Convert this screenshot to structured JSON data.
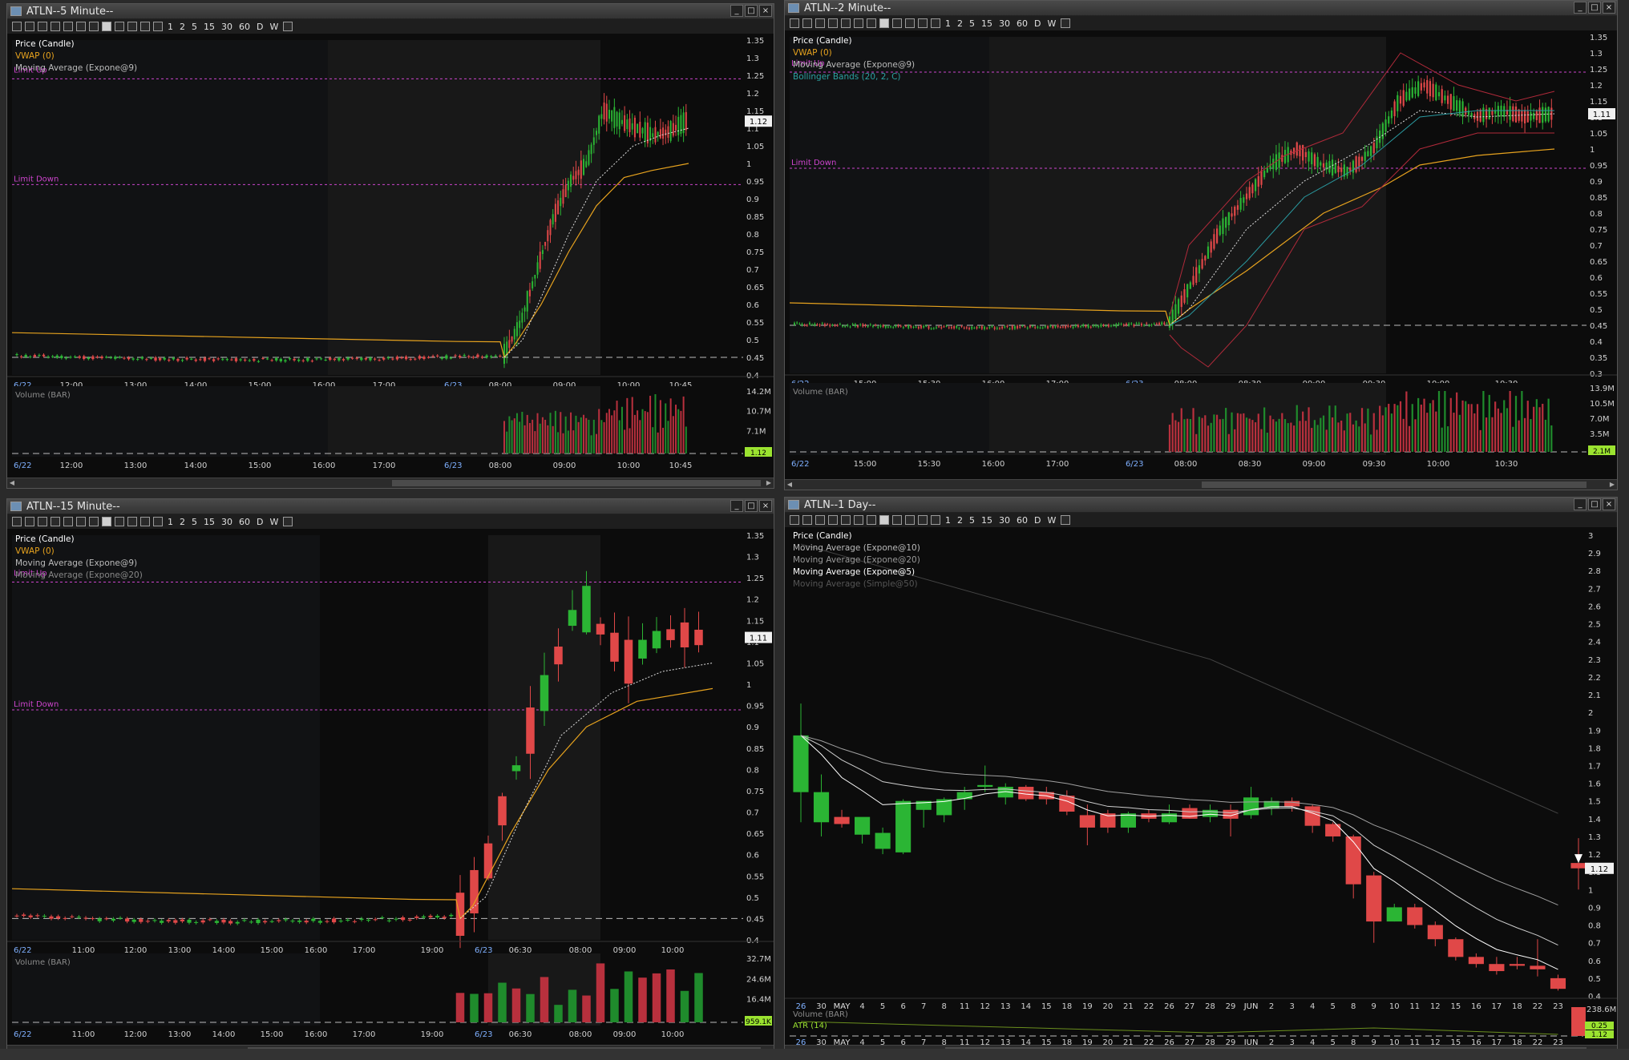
{
  "toolbar_items": [
    "1",
    "2",
    "5",
    "15",
    "30",
    "60",
    "D",
    "W"
  ],
  "colors": {
    "up": "#2bb534",
    "down": "#e04848",
    "vwap": "#e6a21e",
    "ma": "#c8c8c8",
    "limit": "#cc44cc",
    "bb": "#b02a3a",
    "grid": "#1a1a1a"
  },
  "panes": [
    {
      "title": "ATLN--5 Minute--",
      "legend": [
        "Price (Candle)",
        "VWAP (0)",
        "Moving Average (Expone@9)"
      ],
      "legend_colors": [
        "#ffffff",
        "#e6a21e",
        "#bbbbbb"
      ],
      "limit_up_label": "Limit Up",
      "limit_down_label": "Limit Down",
      "price_label": "1.12",
      "volume_label": "Volume (BAR)",
      "volume_price_label": "1.12",
      "price_axis": [
        "1.35",
        "1.3",
        "1.25",
        "1.2",
        "1.15",
        "1.1",
        "1.05",
        "1",
        "0.95",
        "0.9",
        "0.85",
        "0.8",
        "0.75",
        "0.7",
        "0.65",
        "0.6",
        "0.55",
        "0.5",
        "0.45",
        "0.4"
      ],
      "volume_axis": [
        "14.2M",
        "10.7M",
        "7.1M",
        "3.6M"
      ],
      "time_axis": [
        "6/22",
        "12:00",
        "13:00",
        "14:00",
        "15:00",
        "16:00",
        "17:00",
        "6/23",
        "08:00",
        "09:00",
        "10:00",
        "10:45"
      ]
    },
    {
      "title": "ATLN--2 Minute--",
      "legend": [
        "Price (Candle)",
        "VWAP (0)",
        "Moving Average (Expone@9)",
        "Bollinger Bands (20, 2, C)"
      ],
      "legend_colors": [
        "#ffffff",
        "#e6a21e",
        "#bbbbbb",
        "#2aa0a0"
      ],
      "limit_up_label": "Limit Up",
      "limit_down_label": "Limit Down",
      "price_label": "1.11",
      "volume_label": "Volume (BAR)",
      "volume_price_label": "2.1M",
      "price_axis": [
        "1.35",
        "1.3",
        "1.25",
        "1.2",
        "1.15",
        "1.1",
        "1.05",
        "1",
        "0.95",
        "0.9",
        "0.85",
        "0.8",
        "0.75",
        "0.7",
        "0.65",
        "0.6",
        "0.55",
        "0.5",
        "0.45",
        "0.4",
        "0.35",
        "0.3"
      ],
      "volume_axis": [
        "13.9M",
        "10.5M",
        "7.0M",
        "3.5M",
        "0"
      ],
      "time_axis": [
        "6/22",
        "15:00",
        "15:30",
        "16:00",
        "17:00",
        "6/23",
        "08:00",
        "08:30",
        "09:00",
        "09:30",
        "10:00",
        "10:30"
      ]
    },
    {
      "title": "ATLN--15 Minute--",
      "legend": [
        "Price (Candle)",
        "VWAP (0)",
        "Moving Average (Expone@9)",
        "Moving Average (Expone@20)"
      ],
      "legend_colors": [
        "#ffffff",
        "#e6a21e",
        "#bbbbbb",
        "#888888"
      ],
      "limit_up_label": "Limit Up",
      "limit_down_label": "Limit Down",
      "price_label": "1.11",
      "volume_label": "Volume (BAR)",
      "volume_price_label": "959.1K",
      "price_axis": [
        "1.35",
        "1.3",
        "1.25",
        "1.2",
        "1.15",
        "1.1",
        "1.05",
        "1",
        "0.95",
        "0.9",
        "0.85",
        "0.8",
        "0.75",
        "0.7",
        "0.65",
        "0.6",
        "0.55",
        "0.5",
        "0.45",
        "0.4"
      ],
      "volume_axis": [
        "32.7M",
        "24.6M",
        "16.4M",
        "8.2M"
      ],
      "time_axis": [
        "6/22",
        "11:00",
        "12:00",
        "13:00",
        "14:00",
        "15:00",
        "16:00",
        "17:00",
        "19:00",
        "6/23",
        "06:30",
        "08:00",
        "09:00",
        "10:00"
      ]
    },
    {
      "title": "ATLN--1 Day--",
      "legend": [
        "Price (Candle)",
        "Moving Average (Expone@10)",
        "Moving Average (Expone@20)",
        "Moving Average (Expone@5)",
        "Moving Average (Simple@50)"
      ],
      "legend_colors": [
        "#ffffff",
        "#bbbbbb",
        "#999999",
        "#ffffff",
        "#555555"
      ],
      "limit_up_label": "",
      "limit_down_label": "",
      "price_label": "1.12",
      "volume_label": "Volume (BAR)",
      "atr_label": "ATR (14)",
      "volume_price_label": "0.25",
      "volume_price_label2": "1.12",
      "price_axis": [
        "3",
        "2.9",
        "2.8",
        "2.7",
        "2.6",
        "2.5",
        "2.4",
        "2.3",
        "2.2",
        "2.1",
        "2",
        "1.9",
        "1.8",
        "1.7",
        "1.6",
        "1.5",
        "1.4",
        "1.3",
        "1.2",
        "1.1",
        "1",
        "0.9",
        "0.8",
        "0.7",
        "0.6",
        "0.5",
        "0.4"
      ],
      "volume_axis": [
        "238.6M"
      ],
      "time_axis": [
        "26",
        "30",
        "MAY",
        "4",
        "5",
        "6",
        "7",
        "8",
        "11",
        "12",
        "13",
        "14",
        "15",
        "18",
        "19",
        "20",
        "21",
        "22",
        "26",
        "27",
        "28",
        "29",
        "JUN",
        "2",
        "3",
        "4",
        "5",
        "8",
        "9",
        "10",
        "11",
        "12",
        "15",
        "16",
        "17",
        "18",
        "22",
        "23"
      ]
    }
  ],
  "chart_data": [
    {
      "type": "candlestick",
      "title": "ATLN--5 Minute--",
      "ylim": [
        0.4,
        1.35
      ],
      "limit_up": 1.24,
      "limit_down": 0.94,
      "x": [
        "6/22",
        "12:00",
        "13:00",
        "14:00",
        "15:00",
        "16:00",
        "17:00",
        "6/23",
        "08:00",
        "09:00",
        "10:00",
        "10:45"
      ],
      "close_path": [
        0.45,
        0.44,
        0.43,
        0.44,
        0.44,
        0.44,
        0.45,
        0.45,
        0.48,
        0.85,
        1.12,
        1.12
      ],
      "last": 1.12
    },
    {
      "type": "candlestick",
      "title": "ATLN--2 Minute--",
      "ylim": [
        0.3,
        1.35
      ],
      "limit_up": 1.24,
      "limit_down": 0.94,
      "x": [
        "6/22",
        "15:00",
        "15:30",
        "16:00",
        "17:00",
        "6/23",
        "08:00",
        "08:30",
        "09:00",
        "09:30",
        "10:00",
        "10:30"
      ],
      "close_path": [
        0.45,
        0.45,
        0.45,
        0.44,
        0.44,
        0.44,
        0.5,
        0.85,
        0.95,
        1.15,
        1.1,
        1.11
      ],
      "last": 1.11
    },
    {
      "type": "candlestick",
      "title": "ATLN--15 Minute--",
      "ylim": [
        0.4,
        1.35
      ],
      "limit_up": 1.24,
      "limit_down": 0.94,
      "x": [
        "6/22",
        "11:00",
        "12:00",
        "13:00",
        "14:00",
        "15:00",
        "16:00",
        "17:00",
        "19:00",
        "6/23",
        "06:30",
        "08:00",
        "09:00",
        "10:00"
      ],
      "close_path": [
        0.5,
        0.48,
        0.47,
        0.46,
        0.45,
        0.45,
        0.45,
        0.45,
        0.45,
        0.45,
        0.45,
        0.6,
        1.15,
        1.11
      ],
      "last": 1.11
    },
    {
      "type": "candlestick",
      "title": "ATLN--1 Day--",
      "ylim": [
        0.4,
        3.0
      ],
      "x": [
        "26",
        "30",
        "MAY",
        "4",
        "5",
        "6",
        "7",
        "8",
        "11",
        "12",
        "13",
        "14",
        "15",
        "18",
        "19",
        "20",
        "21",
        "22",
        "26",
        "27",
        "28",
        "29",
        "JUN",
        "2",
        "3",
        "4",
        "5",
        "8",
        "9",
        "10",
        "11",
        "12",
        "15",
        "16",
        "17",
        "18",
        "22",
        "23"
      ],
      "candles": [
        {
          "o": 1.55,
          "h": 2.05,
          "l": 1.38,
          "c": 1.87
        },
        {
          "o": 1.38,
          "h": 1.65,
          "l": 1.3,
          "c": 1.55
        },
        {
          "o": 1.41,
          "h": 1.45,
          "l": 1.35,
          "c": 1.37
        },
        {
          "o": 1.31,
          "h": 1.4,
          "l": 1.26,
          "c": 1.41
        },
        {
          "o": 1.23,
          "h": 1.35,
          "l": 1.2,
          "c": 1.32
        },
        {
          "o": 1.21,
          "h": 1.51,
          "l": 1.2,
          "c": 1.5
        },
        {
          "o": 1.45,
          "h": 1.5,
          "l": 1.35,
          "c": 1.5
        },
        {
          "o": 1.42,
          "h": 1.52,
          "l": 1.38,
          "c": 1.51
        },
        {
          "o": 1.51,
          "h": 1.58,
          "l": 1.45,
          "c": 1.55
        },
        {
          "o": 1.58,
          "h": 1.7,
          "l": 1.55,
          "c": 1.59
        },
        {
          "o": 1.52,
          "h": 1.6,
          "l": 1.48,
          "c": 1.58
        },
        {
          "o": 1.58,
          "h": 1.59,
          "l": 1.5,
          "c": 1.51
        },
        {
          "o": 1.55,
          "h": 1.58,
          "l": 1.48,
          "c": 1.51
        },
        {
          "o": 1.53,
          "h": 1.56,
          "l": 1.42,
          "c": 1.44
        },
        {
          "o": 1.42,
          "h": 1.48,
          "l": 1.25,
          "c": 1.35
        },
        {
          "o": 1.43,
          "h": 1.45,
          "l": 1.32,
          "c": 1.35
        },
        {
          "o": 1.35,
          "h": 1.44,
          "l": 1.32,
          "c": 1.43
        },
        {
          "o": 1.43,
          "h": 1.45,
          "l": 1.38,
          "c": 1.4
        },
        {
          "o": 1.38,
          "h": 1.48,
          "l": 1.37,
          "c": 1.43
        },
        {
          "o": 1.46,
          "h": 1.48,
          "l": 1.4,
          "c": 1.4
        },
        {
          "o": 1.41,
          "h": 1.48,
          "l": 1.38,
          "c": 1.45
        },
        {
          "o": 1.45,
          "h": 1.48,
          "l": 1.3,
          "c": 1.4
        },
        {
          "o": 1.42,
          "h": 1.58,
          "l": 1.4,
          "c": 1.52
        },
        {
          "o": 1.46,
          "h": 1.52,
          "l": 1.42,
          "c": 1.5
        },
        {
          "o": 1.5,
          "h": 1.52,
          "l": 1.44,
          "c": 1.47
        },
        {
          "o": 1.47,
          "h": 1.48,
          "l": 1.32,
          "c": 1.36
        },
        {
          "o": 1.37,
          "h": 1.38,
          "l": 1.27,
          "c": 1.3
        },
        {
          "o": 1.3,
          "h": 1.31,
          "l": 0.95,
          "c": 1.03
        },
        {
          "o": 1.08,
          "h": 1.1,
          "l": 0.7,
          "c": 0.82
        },
        {
          "o": 0.82,
          "h": 0.92,
          "l": 0.82,
          "c": 0.9
        },
        {
          "o": 0.9,
          "h": 0.92,
          "l": 0.78,
          "c": 0.8
        },
        {
          "o": 0.8,
          "h": 0.82,
          "l": 0.68,
          "c": 0.72
        },
        {
          "o": 0.72,
          "h": 0.73,
          "l": 0.6,
          "c": 0.62
        },
        {
          "o": 0.62,
          "h": 0.64,
          "l": 0.56,
          "c": 0.58
        },
        {
          "o": 0.58,
          "h": 0.62,
          "l": 0.52,
          "c": 0.54
        },
        {
          "o": 0.58,
          "h": 0.62,
          "l": 0.55,
          "c": 0.57
        },
        {
          "o": 0.57,
          "h": 0.72,
          "l": 0.51,
          "c": 0.55
        },
        {
          "o": 0.5,
          "h": 0.52,
          "l": 0.43,
          "c": 0.44
        },
        {
          "o": 1.15,
          "h": 1.29,
          "l": 1.0,
          "c": 1.12
        }
      ],
      "last": 1.12
    }
  ]
}
